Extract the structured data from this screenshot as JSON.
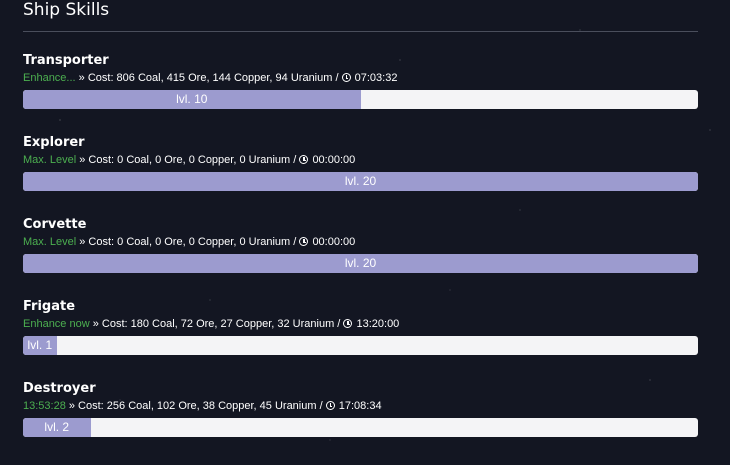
{
  "page": {
    "title": "Ship Skills"
  },
  "skills": [
    {
      "name": "Transporter",
      "status": "Enhance...",
      "cost": " » Cost: 806 Coal, 415 Ore, 144 Copper, 94 Uranium / ",
      "time": "07:03:32",
      "level_label": "lvl. 10",
      "level_fraction": 0.5
    },
    {
      "name": "Explorer",
      "status": "Max. Level",
      "cost": " » Cost: 0 Coal, 0 Ore, 0 Copper, 0 Uranium / ",
      "time": "00:00:00",
      "level_label": "lvl. 20",
      "level_fraction": 1.0
    },
    {
      "name": "Corvette",
      "status": "Max. Level",
      "cost": " » Cost: 0 Coal, 0 Ore, 0 Copper, 0 Uranium / ",
      "time": "00:00:00",
      "level_label": "lvl. 20",
      "level_fraction": 1.0
    },
    {
      "name": "Frigate",
      "status": "Enhance now",
      "cost": " » Cost: 180 Coal, 72 Ore, 27 Copper, 32 Uranium / ",
      "time": "13:20:00",
      "level_label": "lvl. 1",
      "level_fraction": 0.05
    },
    {
      "name": "Destroyer",
      "status": "13:53:28",
      "cost": " » Cost: 256 Coal, 102 Ore, 38 Copper, 45 Uranium / ",
      "time": "17:08:34",
      "level_label": "lvl. 2",
      "level_fraction": 0.1
    }
  ],
  "colors": {
    "status_green": "#4caf50",
    "bar_fill": "#9c9bcf",
    "bar_track": "#f4f4f6",
    "background": "#131622"
  },
  "icons": {
    "clock": "clock-icon"
  }
}
